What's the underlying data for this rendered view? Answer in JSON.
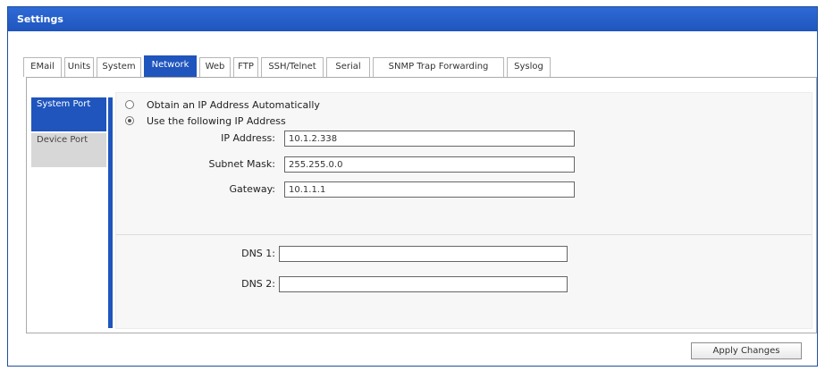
{
  "title": "Settings",
  "tabs": [
    {
      "label": "EMail",
      "name": "tab-email"
    },
    {
      "label": "Units",
      "name": "tab-units"
    },
    {
      "label": "System",
      "name": "tab-system"
    },
    {
      "label": "Network",
      "name": "tab-network",
      "active": true
    },
    {
      "label": "Web",
      "name": "tab-web"
    },
    {
      "label": "FTP",
      "name": "tab-ftp"
    },
    {
      "label": "SSH/Telnet",
      "name": "tab-ssh-telnet"
    },
    {
      "label": "Serial",
      "name": "tab-serial"
    },
    {
      "label": "SNMP Trap Forwarding",
      "name": "tab-snmp-trap-forwarding"
    },
    {
      "label": "Syslog",
      "name": "tab-syslog"
    }
  ],
  "side_tabs": {
    "system_port": "System Port",
    "device_port": "Device Port"
  },
  "ip_mode": {
    "auto_label": "Obtain an IP Address Automatically",
    "manual_label": "Use the following IP Address",
    "selected": "manual"
  },
  "fields": {
    "ip_label": "IP Address:",
    "ip_value": "10.1.2.338",
    "subnet_label": "Subnet Mask:",
    "subnet_value": "255.255.0.0",
    "gateway_label": "Gateway:",
    "gateway_value": "10.1.1.1",
    "dns1_label": "DNS 1:",
    "dns1_value": "",
    "dns2_label": "DNS 2:",
    "dns2_value": ""
  },
  "apply_label": "Apply Changes",
  "colors": {
    "accent": "#1f55bd",
    "inactive_tab": "#d7d7d7",
    "content_bg": "#f7f7f7"
  }
}
